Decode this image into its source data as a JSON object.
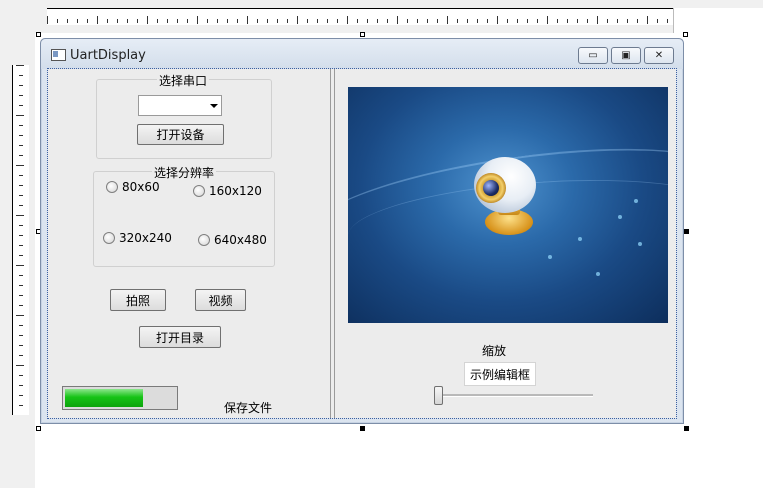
{
  "window": {
    "title": "UartDisplay",
    "minimize_glyph": "▭",
    "maximize_glyph": "▣",
    "close_glyph": "✕"
  },
  "serial": {
    "group_title": "选择串口",
    "port_value": "",
    "open_device_label": "打开设备"
  },
  "resolution": {
    "group_title": "选择分辨率",
    "options": [
      "80x60",
      "160x120",
      "320x240",
      "640x480"
    ]
  },
  "actions": {
    "photo_label": "拍照",
    "video_label": "视频",
    "open_dir_label": "打开目录"
  },
  "save": {
    "label": "保存文件",
    "progress_fraction": 0.71
  },
  "viewer": {
    "zoom_label": "缩放",
    "edit_box_text": "示例编辑框",
    "slider_fraction": 0.0
  },
  "icons": {
    "app": "window-app-icon",
    "combo_arrow": "chevron-down-icon"
  },
  "colors": {
    "progress_green": "#16c316",
    "titlebar": "#dbe4ef",
    "image_bg": "#1a4a85"
  }
}
